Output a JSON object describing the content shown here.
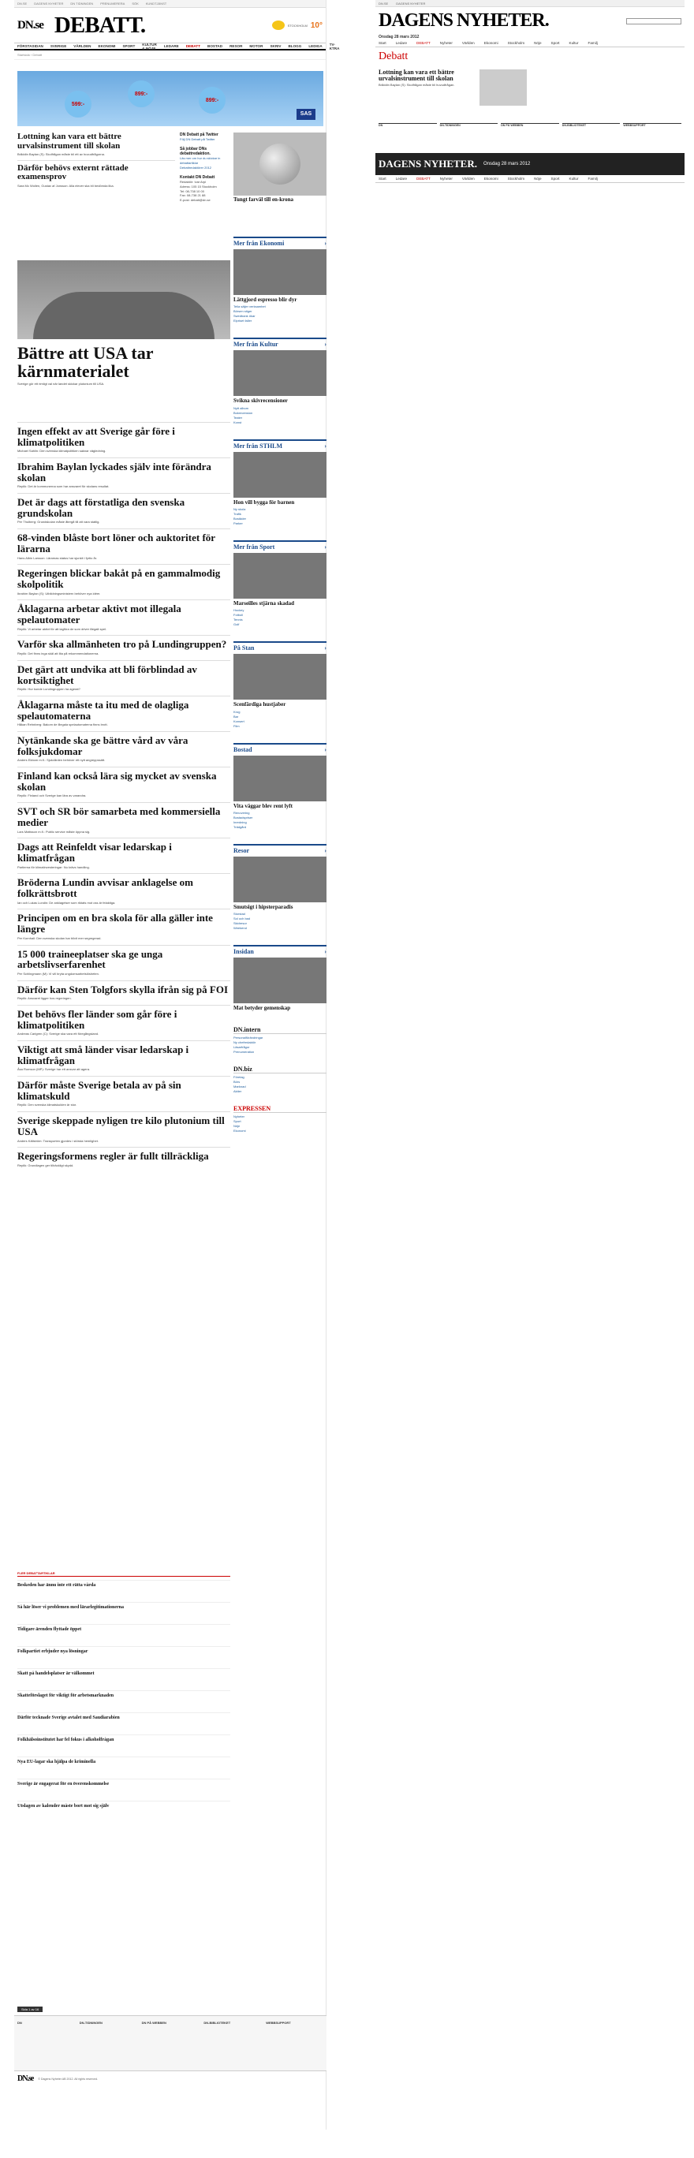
{
  "page": {
    "date": "Onsdag 28 mars 2012",
    "uppdaterad": "UPPDATERAD 28 MARS 2012"
  },
  "topstrip": [
    "DN.SE",
    "DAGENS NYHETER",
    "DN TIDNINGEN",
    "PRENUMERERA",
    "SÖK",
    "KUNDTJÄNST"
  ],
  "masthead": {
    "dn": "DN.se",
    "section": "DEBATT.",
    "weather": {
      "city": "STOCKHOLM",
      "temp": "10°"
    }
  },
  "nav": {
    "items": [
      "FÖRSTASIDAN",
      "SVERIGE",
      "VÄRLDEN",
      "EKONOMI",
      "SPORT",
      "KULTUR & NÖJE",
      "LEDARE",
      "DEBATT",
      "BOSTAD",
      "RESOR",
      "MOTOR",
      "SKRIV",
      "BLOGG",
      "LEDIGA",
      "TV-KTRA"
    ],
    "active": 7
  },
  "breadcrumb": "Startsida › Debatt",
  "ad": {
    "label": "SAS",
    "prices": [
      "599:-",
      "899:-",
      "899:-"
    ]
  },
  "col2": {
    "title": "DN Debatt på Twitter",
    "lines": [
      "Följ DN Debatt på Twitter"
    ],
    "kontakt_title": "Kontakt DN Debatt",
    "kontakt": [
      "Redaktör: Ivar Arpi",
      "Adress: 105 15 Stockholm",
      "Tel: 08-738 10 00",
      "Fax: 08-738 21 88",
      "E-post: debatt@dn.se"
    ],
    "sub_title": "Så jobbar DNs debattredaktion.",
    "sub_lines": [
      "Läs mer om hur du skickar in debattartiklar",
      "Debattredaktörer 2012"
    ]
  },
  "coin_caption": "Tungt farväl till en-krona",
  "articles": [
    {
      "title": "Lottning kan vara ett bättre urvalsinstrument till skolan",
      "dek": "Bråddin Baylan (S): Skolfrågan måste bli ett av huvudfrågorna.",
      "size": "l"
    },
    {
      "title": "Därför behövs externt rättade examensprov",
      "dek": "Sara Mc Wollen, Gustav af Jonsson: Alla elever ska bli bedömda lika.",
      "size": "l"
    },
    {
      "title": "Bättre att USA tar kärnmaterialet",
      "dek": "Sverige gör ett rimligt val när landet skickar plutonium till USA.",
      "size": "xl"
    },
    {
      "title": "Ingen effekt av att Sverige går före i klimatpolitiken",
      "dek": "Michael Sahlin: Den svenska klimatpolitiken saknar vägledning.",
      "size": "l"
    },
    {
      "title": "Ibrahim Baylan lyckades själv inte förändra skolan",
      "dek": "Replik: Det är kommunerna som har ansvaret för skolans resultat.",
      "size": "l"
    },
    {
      "title": "Det är dags att förstatliga den svenska grundskolan",
      "dek": "Per Thulberg: Grundskolan måste återgå till att vara statlig.",
      "size": "l"
    },
    {
      "title": "68-vinden blåste bort löner och auktoritet för lärarna",
      "dek": "Hans Albin Larsson: Lärarnas status har sjunkit i fyrtio år.",
      "size": "l"
    },
    {
      "title": "Regeringen blickar bakåt på en gammalmodig skolpolitik",
      "dek": "Ibrahim Baylan (S): Utbildningsministern behöver nya idéer.",
      "size": "l"
    },
    {
      "title": "Åklagarna arbetar aktivt mot illegala spelautomater",
      "dek": "Replik: Vi arbetar aktivt för att lagföra de som driver illegalt spel.",
      "size": "l"
    },
    {
      "title": "Varför ska allmänheten tro på Lundingruppen?",
      "dek": "Replik: Det finns inga skäl att lita på rekommendationerna.",
      "size": "l"
    },
    {
      "title": "Det gärt att undvika att bli förblindad av kortsiktighet",
      "dek": "Replik: Hur kunde Lundingruppen ha agerat?",
      "size": "l"
    },
    {
      "title": "Åklagarna måste ta itu med de olagliga spelautomaterna",
      "dek": "Håkan Rehnberg: Bakom de illegala spelautomaterna finns brott.",
      "size": "l"
    },
    {
      "title": "Nytänkande ska ge bättre vård av våra folksjukdomar",
      "dek": "Anders Ekbom m.fl.: Sjukvården behöver ett nytt angreppssätt.",
      "size": "l"
    },
    {
      "title": "Finland kan också lära sig mycket av svenska skolan",
      "dek": "Replik: Finland och Sverige kan lära av varandra.",
      "size": "l"
    },
    {
      "title": "SVT och SR bör samarbeta med kommersiella medier",
      "dek": "Lars Mattsson m.fl.: Public service måste öppna sig.",
      "size": "l"
    },
    {
      "title": "Dags att Reinfeldt visar ledarskap i klimatfrågan",
      "dek": "Partierna för klimatinvesteringar: Nu krävs handling.",
      "size": "l"
    },
    {
      "title": "Bröderna Lundin avvisar anklagelse om folkrättsbrott",
      "dek": "Ian och Lukas Lundin: De anklagelser som riktats mot oss är felaktiga.",
      "size": "l"
    },
    {
      "title": "Principen om en bra skola för alla gäller inte längre",
      "dek": "Per Kornhall: Den svenska skolan har blivit mer segregerad.",
      "size": "l"
    },
    {
      "title": "15 000 traineeplatser ska ge unga arbetslivserfarenhet",
      "dek": "Per Schlingmann (M): Vi vill bryta ungdomsarbetslösheten.",
      "size": "l"
    },
    {
      "title": "Därför kan Sten Tolgfors skylla ifrån sig på FOI",
      "dek": "Replik: Ansvaret ligger hos regeringen.",
      "size": "l"
    },
    {
      "title": "Det behövs fler länder som går före i klimatpolitiken",
      "dek": "Andreas Carlgren (C): Sverige ska vara ett föregångsland.",
      "size": "l"
    },
    {
      "title": "Viktigt att små länder visar ledarskap i klimatfrågan",
      "dek": "Åsa Romson (MP): Sverige har ett ansvar att agera.",
      "size": "l"
    },
    {
      "title": "Därför måste Sverige betala av på sin klimatskuld",
      "dek": "Replik: Den svenska klimatskulden är stor.",
      "size": "l"
    },
    {
      "title": "Sverige skeppade nyligen tre kilo plutonium till USA",
      "dek": "Anders Källström: Transporten gjordes i största hemlighet.",
      "size": "l"
    },
    {
      "title": "Regeringsformens regler är fullt tillräckliga",
      "dek": "Replik: Grundlagen ger tillräckligt skydd.",
      "size": "l"
    }
  ],
  "older_header": "FLER DEBATTARTIKLAR",
  "older": [
    "Beskeden har ännu inte ett rätta vårda",
    "Så här löser vi problemen med lärarlegitimationerna",
    "Tidigare ärenden flyttade öppet",
    "Folkpartiet erbjuder nya lösningar",
    "Skatt på handelsplatser är välkommet",
    "Skatteförslaget för viktigt för arbetsmarknaden",
    "Därför tecknade Sverige avtalet med Saudiarabien",
    "Folkhälsoinstitutet har fel fokus i alkoholfrågan",
    "Nya EU-lagar ska hjälpa de kriminella",
    "Sverige är engagerat för en överenskommelse",
    "Utslagen av kalender måste bort mot sig själv"
  ],
  "sidebar": {
    "ekonomi": {
      "title": "Mer från Ekonomi",
      "headline": "Lättgjord espresso blir dyr",
      "links": [
        "Telia säljer verksamhet",
        "Börsen stiger",
        "Swedbank ökar",
        "Elpriset faller"
      ]
    },
    "kultur": {
      "title": "Mer från Kultur",
      "headline": "Svikna skivrecensioner",
      "links": [
        "Nytt album",
        "Bokrecension",
        "Teater",
        "Konst"
      ]
    },
    "sthlm": {
      "title": "Mer från STHLM",
      "headline": "Hon vill bygga för barnen",
      "links": [
        "Ny skola",
        "Trafik",
        "Bostäder",
        "Parker"
      ]
    },
    "sport": {
      "title": "Mer från Sport",
      "headline": "Marseilles stjärna skadad",
      "links": [
        "Hockey",
        "Fotboll",
        "Tennis",
        "Golf"
      ]
    },
    "pastan": {
      "title": "På Stan",
      "headline": "Scenfärdiga hustjaber",
      "links": [
        "Krog",
        "Bar",
        "Konsert",
        "Film"
      ]
    },
    "bostad": {
      "title": "Bostad",
      "headline": "Vita väggar blev rent lyft",
      "links": [
        "Renovering",
        "Bostadspriser",
        "Inredning",
        "Trädgård"
      ]
    },
    "resor": {
      "title": "Resor",
      "headline": "Smutsigt i hipsterparadis",
      "links": [
        "Storstad",
        "Sol och bad",
        "Skidresor",
        "Weekend"
      ]
    },
    "insidan": {
      "title": "Insidan",
      "headline": "Mat betyder gemenskap"
    },
    "dnintern": {
      "title": "DN.intern",
      "links": [
        "Personalförändringar",
        "Ny chefredaktör",
        "Läsarfrågor",
        "Prenumeration"
      ]
    },
    "dnbiz": {
      "title": "DN.biz",
      "links": [
        "Företag",
        "Börs",
        "Marknad",
        "Aktier"
      ]
    },
    "expressen": {
      "title": "EXPRESSEN",
      "links": [
        "Nyheter",
        "Sport",
        "Nöje",
        "Ekonomi"
      ]
    }
  },
  "footer": {
    "pagelabel": "Sida 1 av 16",
    "cols": [
      "DN",
      "DN-TIDNINGEN",
      "DN PÅ WEBBEN",
      "DN-BIBLIOTEKET",
      "WEBBSUPPORT"
    ],
    "copyright": "© Dagens Nyheter AB 2012. All rights reserved."
  },
  "right_page": {
    "title": "DAGENS NYHETER.",
    "date": "Onsdag 28 mars 2012",
    "nav": [
      "Start",
      "Ledare",
      "DEBATT",
      "Nyheter",
      "Världen",
      "Ekonomi",
      "Stockholm",
      "Nöje",
      "Sport",
      "Kultur",
      "Familj"
    ],
    "section": "Debatt",
    "article_title": "Lottning kan vara ett bättre urvalsinstrument till skolan",
    "article_text": "Bråddin Baylan (S): Skolfrågan måste bli huvudfrågan.",
    "print_title": "DAGENS NYHETER.",
    "print_date": "Onsdag 28 mars 2012"
  }
}
